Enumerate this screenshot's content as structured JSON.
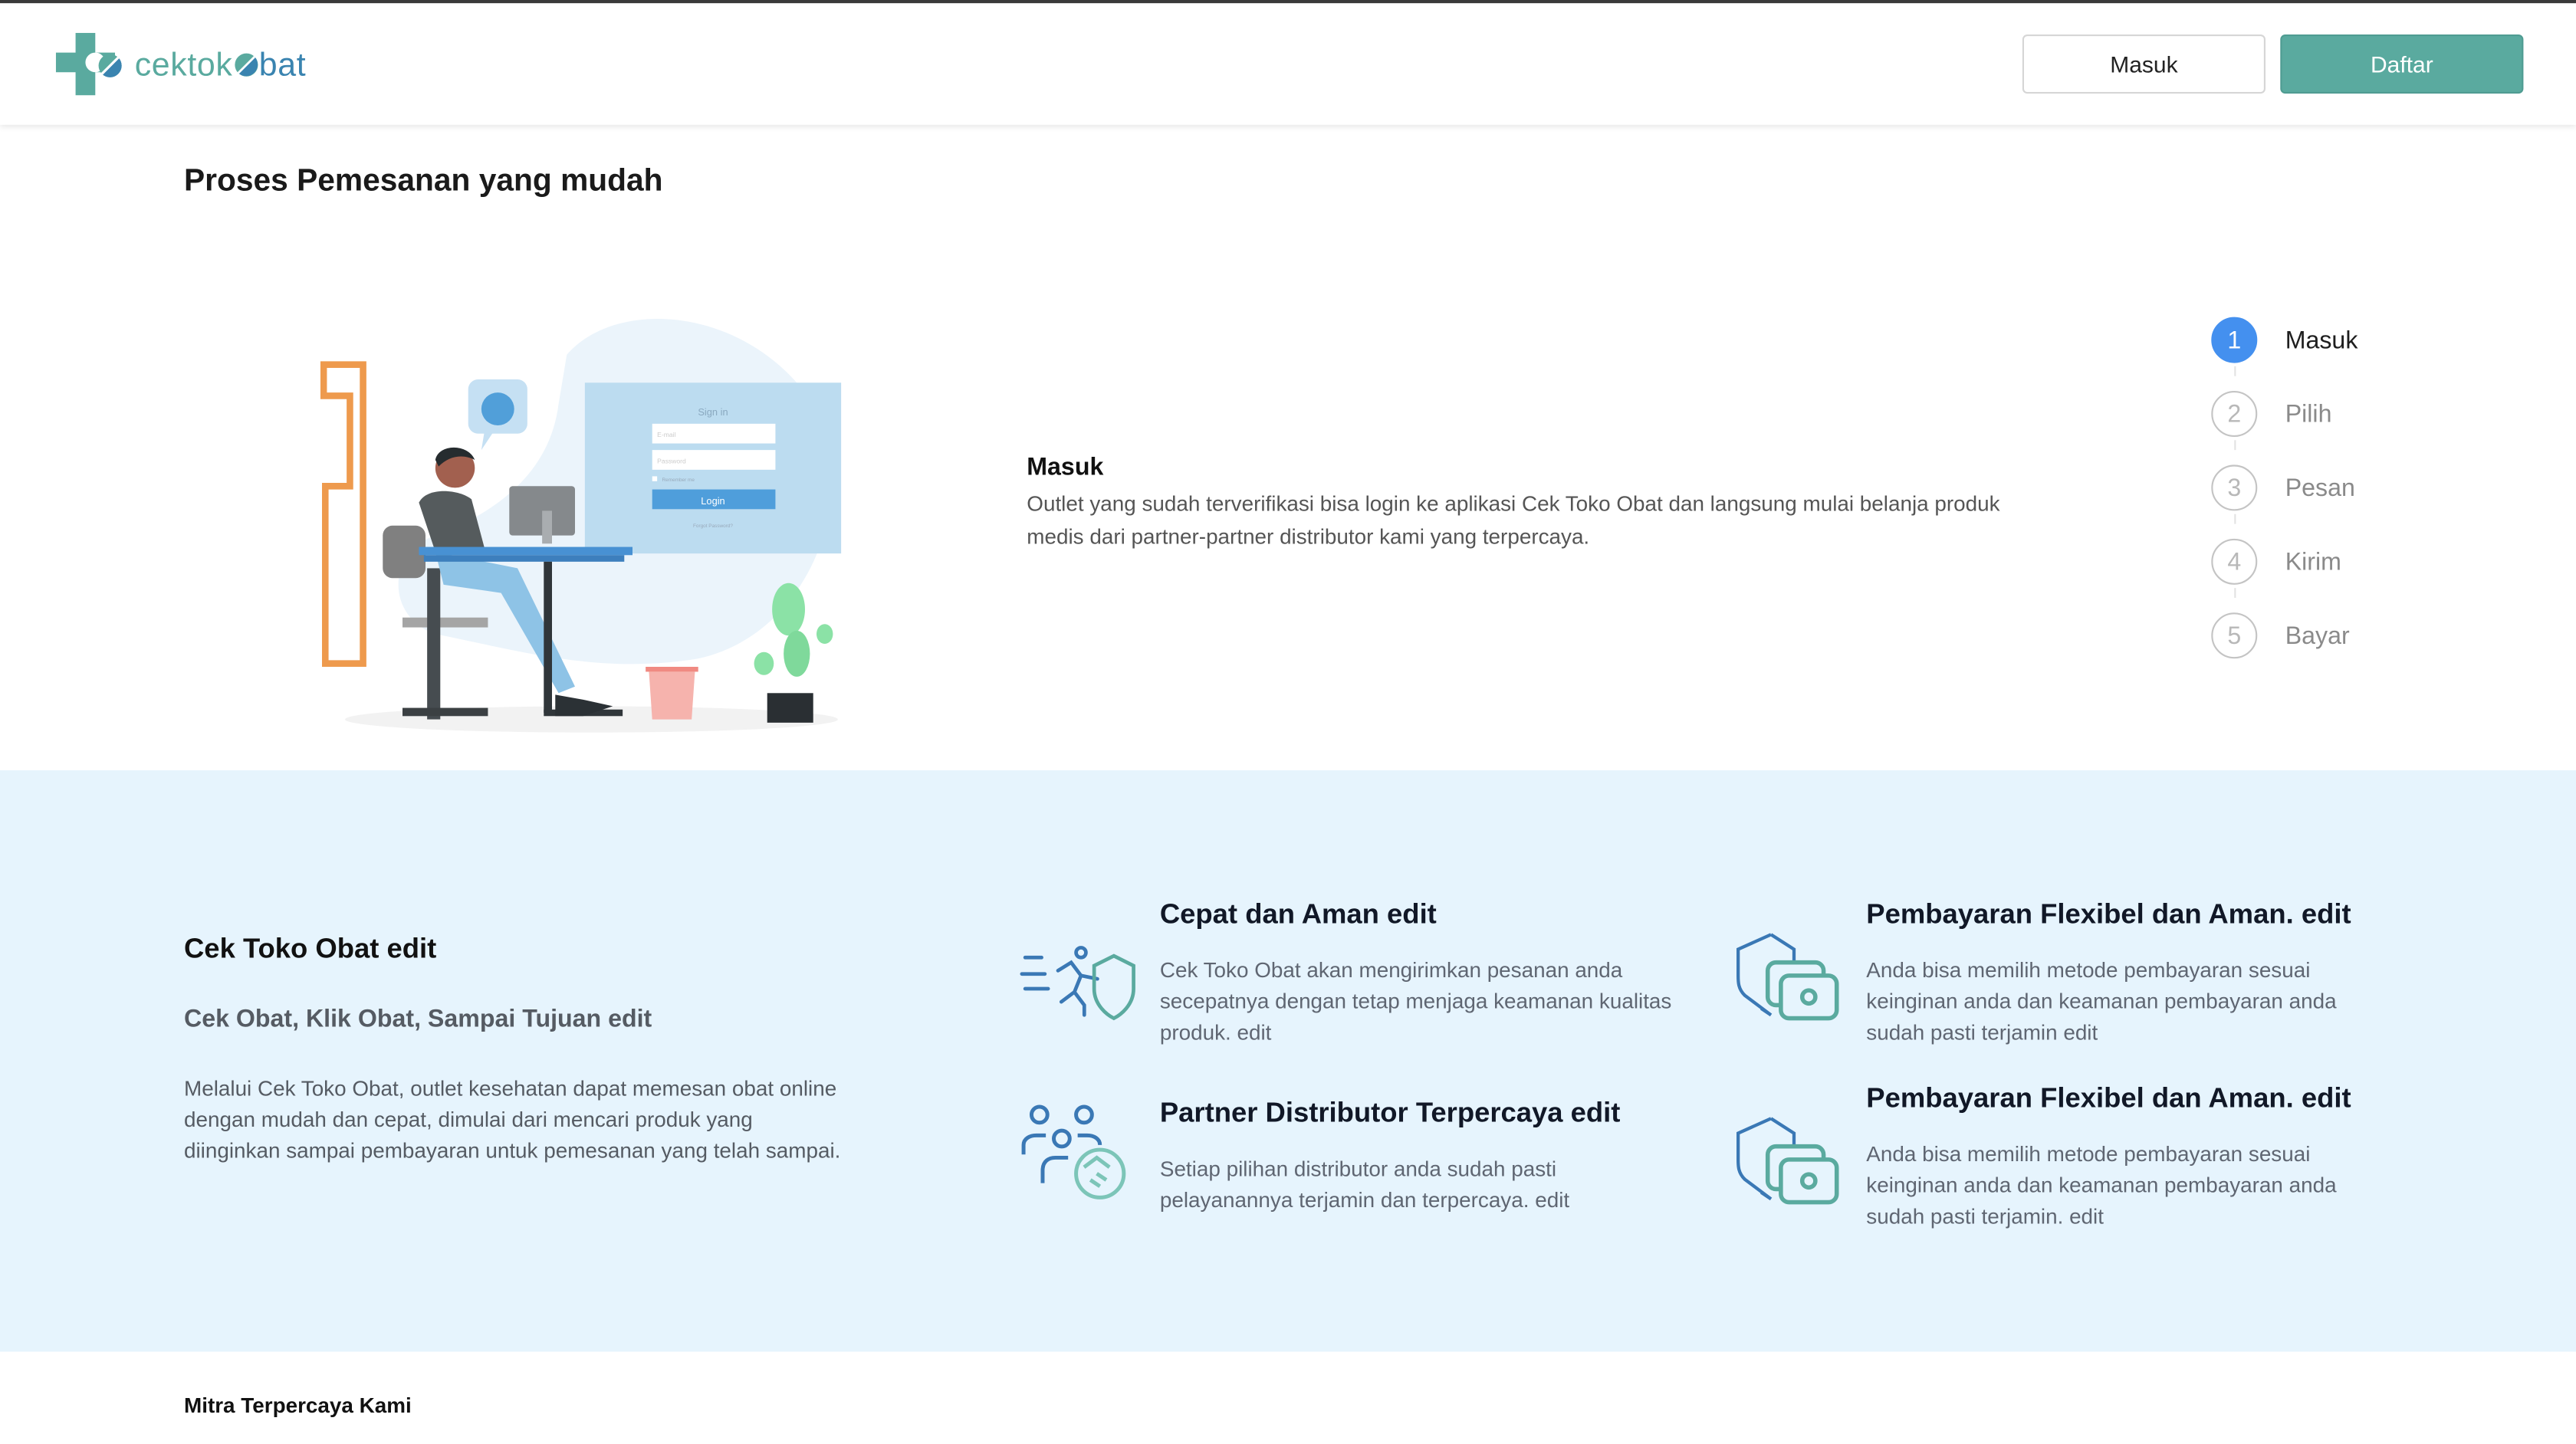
{
  "header": {
    "logo": {
      "text_part1": "cektok",
      "text_part2": "bat",
      "brand_colors": {
        "teal": "#5aaa9f",
        "blue": "#3a84b0"
      }
    },
    "login_label": "Masuk",
    "register_label": "Daftar"
  },
  "process": {
    "title": "Proses Pemesanan yang mudah",
    "illustration": {
      "form_title": "Sign in",
      "email_placeholder": "E-mail",
      "password_placeholder": "Password",
      "remember": "Remember me",
      "login_button": "Login",
      "forgot": "Forgot Password?"
    },
    "current_step": {
      "title": "Masuk",
      "description": "Outlet yang sudah terverifikasi bisa login ke aplikasi Cek Toko Obat dan langsung mulai belanja produk medis dari partner-partner distributor kami yang terpercaya."
    },
    "steps": [
      {
        "number": "1",
        "label": "Masuk",
        "active": true
      },
      {
        "number": "2",
        "label": "Pilih",
        "active": false
      },
      {
        "number": "3",
        "label": "Pesan",
        "active": false
      },
      {
        "number": "4",
        "label": "Kirim",
        "active": false
      },
      {
        "number": "5",
        "label": "Bayar",
        "active": false
      }
    ],
    "active_color": "#4490ef"
  },
  "about": {
    "title": "Cek Toko Obat edit",
    "subtitle": "Cek Obat, Klik Obat, Sampai Tujuan edit",
    "paragraph": "Melalui Cek Toko Obat, outlet kesehatan dapat memesan obat online dengan mudah dan cepat, dimulai dari mencari produk yang diinginkan sampai pembayaran untuk pemesanan yang telah sampai."
  },
  "features": [
    {
      "icon": "fast-secure-icon",
      "title": "Cepat dan Aman edit",
      "text": "Cek Toko Obat akan mengirimkan pesanan anda secepatnya dengan tetap menjaga keamanan kualitas produk. edit"
    },
    {
      "icon": "payment-shield-icon",
      "title": "Pembayaran Flexibel dan Aman. edit",
      "text": "Anda bisa memilih metode pembayaran sesuai keinginan anda dan keamanan pembayaran anda sudah pasti terjamin edit"
    },
    {
      "icon": "partner-handshake-icon",
      "title": "Partner Distributor Terpercaya edit",
      "text": "Setiap pilihan distributor anda sudah pasti pelayanannya terjamin dan terpercaya. edit"
    },
    {
      "icon": "payment-shield-icon",
      "title": "Pembayaran Flexibel dan Aman. edit",
      "text": "Anda bisa memilih metode pembayaran sesuai keinginan anda dan keamanan pembayaran anda sudah pasti terjamin. edit"
    }
  ],
  "partners": {
    "title": "Mitra Terpercaya Kami"
  }
}
